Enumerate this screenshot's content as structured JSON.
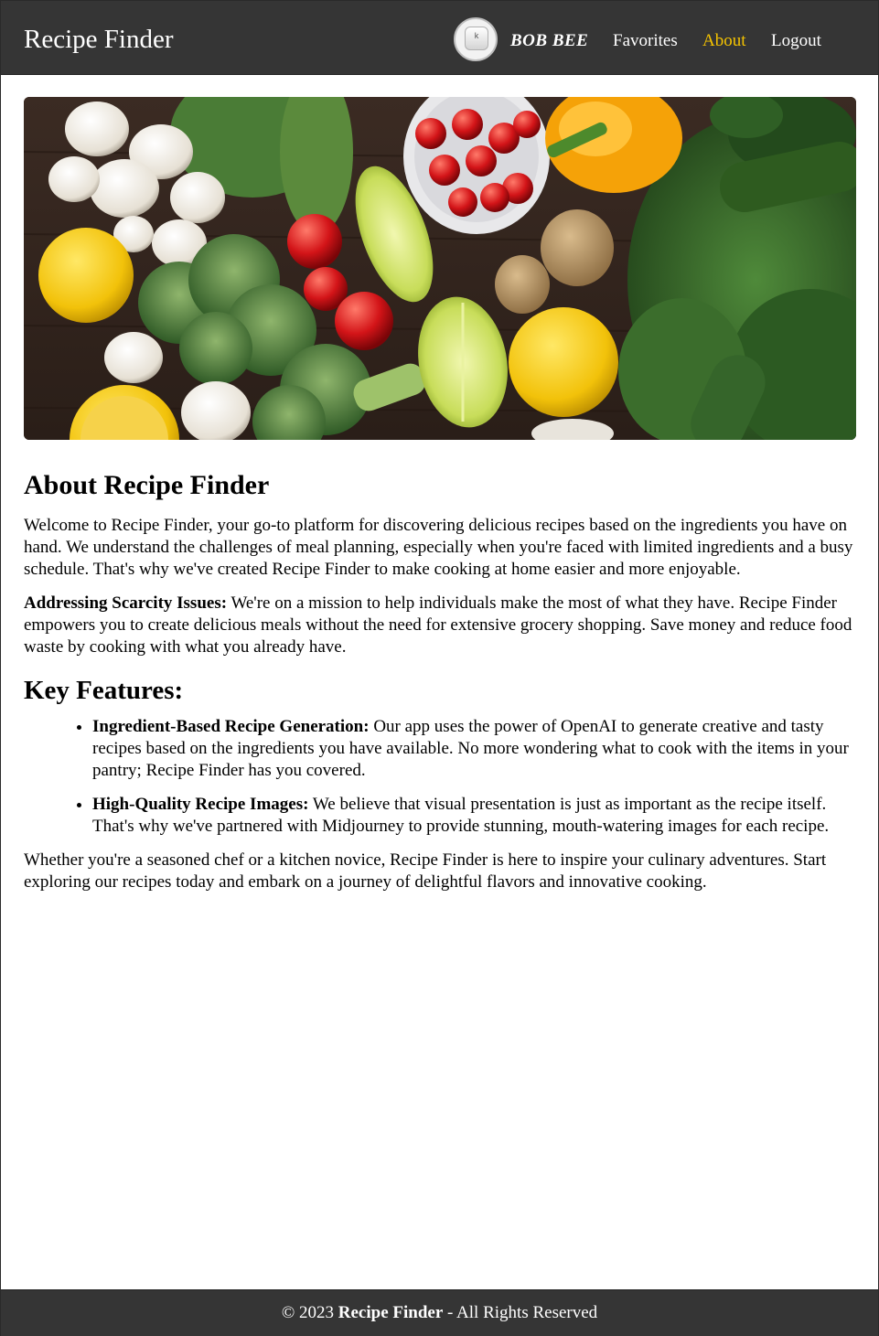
{
  "header": {
    "brand": "Recipe Finder",
    "user_name": "BOB BEE",
    "avatar_key_letter": "k",
    "nav": {
      "favorites": "Favorites",
      "about": "About",
      "logout": "Logout"
    },
    "active_color": "#f5c300"
  },
  "hero": {
    "image": "vegetables-flatlay"
  },
  "main": {
    "title": "About Recipe Finder",
    "intro": "Welcome to Recipe Finder, your go-to platform for discovering delicious recipes based on the ingredients you have on hand. We understand the challenges of meal planning, especially when you're faced with limited ingredients and a busy schedule. That's why we've created Recipe Finder to make cooking at home easier and more enjoyable.",
    "scarcity_label": "Addressing Scarcity Issues:",
    "scarcity_text": " We're on a mission to help individuals make the most of what they have. Recipe Finder empowers you to create delicious meals without the need for extensive grocery shopping. Save money and reduce food waste by cooking with what you already have.",
    "features_title": "Key Features:",
    "features": [
      {
        "label": "Ingredient-Based Recipe Generation:",
        "text": " Our app uses the power of OpenAI to generate creative and tasty recipes based on the ingredients you have available. No more wondering what to cook with the items in your pantry; Recipe Finder has you covered."
      },
      {
        "label": "High-Quality Recipe Images:",
        "text": " We believe that visual presentation is just as important as the recipe itself. That's why we've partnered with Midjourney to provide stunning, mouth-watering images for each recipe."
      }
    ],
    "closing": "Whether you're a seasoned chef or a kitchen novice, Recipe Finder is here to inspire your culinary adventures. Start exploring our recipes today and embark on a journey of delightful flavors and innovative cooking."
  },
  "footer": {
    "prefix": "© 2023 ",
    "brand": "Recipe Finder",
    "suffix": " - All Rights Reserved"
  }
}
